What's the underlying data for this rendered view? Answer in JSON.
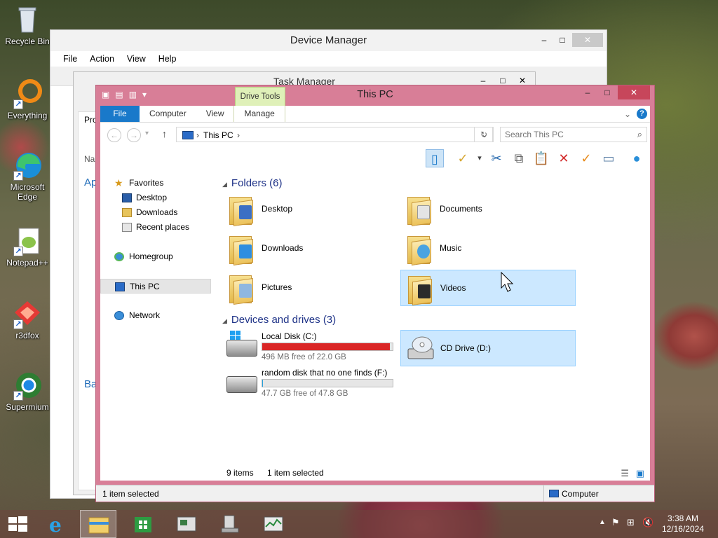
{
  "desktop": {
    "icons": [
      {
        "label": "Recycle Bin",
        "icon": "recycle-bin-icon"
      },
      {
        "label": "Everything",
        "icon": "everything-icon"
      },
      {
        "label": "Microsoft Edge",
        "icon": "edge-icon"
      },
      {
        "label": "Notepad++",
        "icon": "notepad-plus-plus-icon"
      },
      {
        "label": "r3dfox",
        "icon": "r3dfox-icon"
      },
      {
        "label": "Supermium",
        "icon": "supermium-icon"
      }
    ]
  },
  "device_manager": {
    "title": "Device Manager",
    "menu": [
      "File",
      "Action",
      "View",
      "Help"
    ]
  },
  "task_manager": {
    "title": "Task Manager",
    "peek_labels": [
      "Pro",
      "Na",
      "Ap",
      "Ba"
    ]
  },
  "explorer": {
    "title": "This PC",
    "contextual_tab": "Drive Tools",
    "tabs": [
      "File",
      "Computer",
      "View",
      "Manage"
    ],
    "address": {
      "crumb": "This PC",
      "sep": "›"
    },
    "search_placeholder": "Search This PC",
    "nav": {
      "favorites": "Favorites",
      "desktop": "Desktop",
      "downloads": "Downloads",
      "recent": "Recent places",
      "homegroup": "Homegroup",
      "this_pc": "This PC",
      "network": "Network"
    },
    "folders_header": "Folders (6)",
    "folders": [
      {
        "label": "Desktop",
        "badge": "#3b6fc4"
      },
      {
        "label": "Documents",
        "badge": "#d9d9d9"
      },
      {
        "label": "Downloads",
        "badge": "#2f8ee0"
      },
      {
        "label": "Music",
        "badge": "#4aa3e0"
      },
      {
        "label": "Pictures",
        "badge": "#8fb7e0"
      },
      {
        "label": "Videos",
        "badge": "#2b2b2b"
      }
    ],
    "drives_header": "Devices and drives (3)",
    "drives": [
      {
        "name": "Local Disk (C:)",
        "free": "496 MB free of 22.0 GB",
        "used_fraction": 0.978
      },
      {
        "name": "CD Drive (D:)"
      },
      {
        "name": "random disk that no one finds (F:)",
        "free": "47.7 GB free of 47.8 GB",
        "used_fraction": 0.002
      }
    ],
    "status": {
      "items": "9 items",
      "selected": "1 item selected",
      "bottom_selected": "1 item selected",
      "bottom_location": "Computer"
    },
    "colors": {
      "frame": "#d87e97",
      "file_tab": "#1979ca",
      "drive_tools": "#dff0b8",
      "selection": "#cce8ff",
      "low_space": "#da2626"
    }
  },
  "taskbar": {
    "time": "3:38 AM",
    "date": "12/16/2024"
  }
}
